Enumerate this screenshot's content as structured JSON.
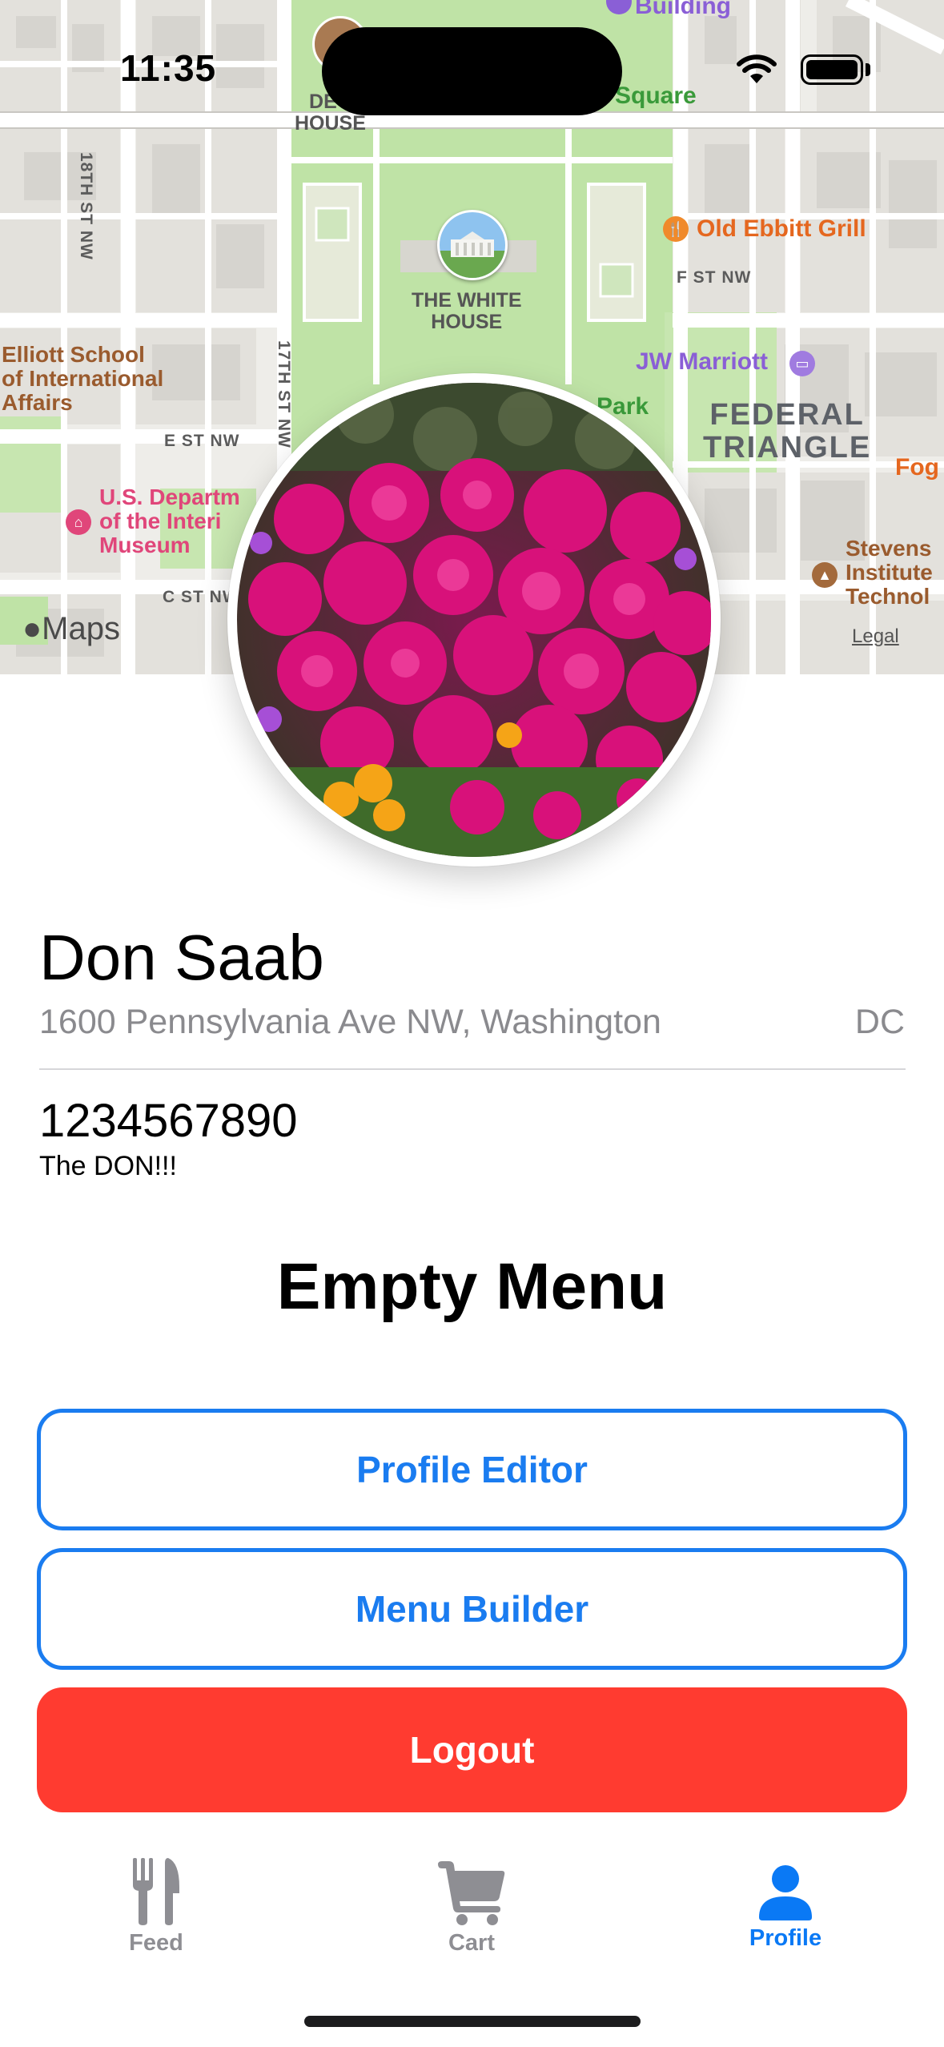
{
  "status_bar": {
    "time": "11:35",
    "icons": [
      "wifi-icon",
      "battery-icon"
    ]
  },
  "map": {
    "attribution": "Maps",
    "legal": "Legal",
    "streets": [
      "18TH ST NW",
      "17TH ST NW",
      "E ST NW",
      "C ST NW",
      "F ST NW"
    ],
    "places": {
      "building_partial": "Building",
      "decatur_house": [
        "DEC",
        "HOUSE"
      ],
      "square_partial": "Square",
      "old_ebbitt": "Old Ebbitt Grill",
      "white_house": [
        "THE WHITE",
        "HOUSE"
      ],
      "elliott_school": [
        "Elliott School",
        "of International",
        "Affairs"
      ],
      "jw_marriott": "JW Marriott",
      "park_partial": "s Park",
      "federal_triangle": [
        "FEDERAL",
        "TRIANGLE"
      ],
      "fog_partial": "Fog",
      "interior_museum": [
        "U.S. Departm",
        "of the Interi",
        "Museum"
      ],
      "stevens": [
        "Stevens",
        "Institute",
        "Technol"
      ]
    },
    "colors": {
      "park": "#bfe3a6",
      "road": "#ffffff",
      "block": "#e5e3df",
      "building": "#d8d6d2"
    }
  },
  "profile": {
    "name": "Don Saab",
    "address": "1600 Pennsylvania Ave NW, Washington",
    "state": "DC",
    "phone": "1234567890",
    "bio": "The DON!!!",
    "avatar": "flower-photo"
  },
  "menu": {
    "title": "Empty Menu"
  },
  "buttons": {
    "profile_editor": "Profile Editor",
    "menu_builder": "Menu Builder",
    "logout": "Logout"
  },
  "tabs": [
    {
      "label": "Feed",
      "icon": "fork-knife-icon",
      "active": false
    },
    {
      "label": "Cart",
      "icon": "cart-icon",
      "active": false
    },
    {
      "label": "Profile",
      "icon": "person-icon",
      "active": true
    }
  ],
  "colors": {
    "accent": "#0a79f5",
    "outline": "#1a7cf0",
    "danger": "#ff3b30",
    "secondary_text": "#8a8a8e",
    "inactive_tab": "#8e8e93"
  }
}
